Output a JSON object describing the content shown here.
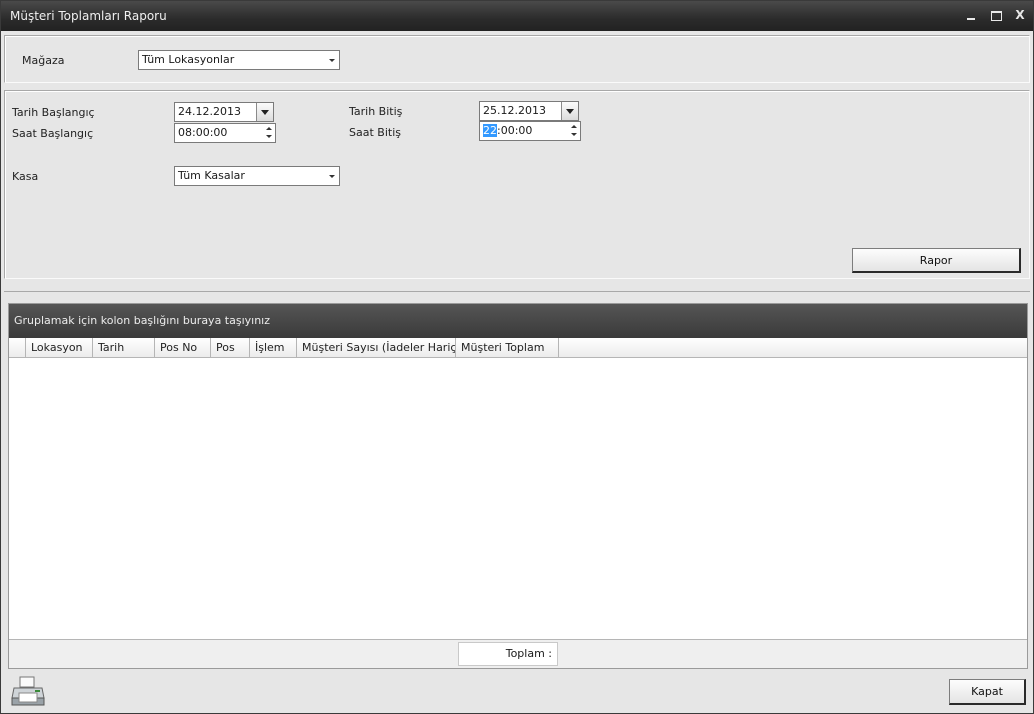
{
  "window": {
    "title": "Müşteri Toplamları Raporu",
    "controls": {
      "minimize": "minimize-icon",
      "maximize": "maximize-icon",
      "close_glyph": "X"
    }
  },
  "store": {
    "label": "Mağaza",
    "value": "Tüm Lokasyonlar"
  },
  "filters": {
    "date_start_label": "Tarih Başlangıç",
    "date_start_value": "24.12.2013",
    "time_start_label": "Saat Başlangıç",
    "time_start_value": "08:00:00",
    "date_end_label": "Tarih Bitiş",
    "date_end_value": "25.12.2013",
    "time_end_label": "Saat Bitiş",
    "time_end_selected": "22",
    "time_end_rest": ":00:00",
    "register_label": "Kasa",
    "register_value": "Tüm Kasalar",
    "report_button": "Rapor"
  },
  "grid": {
    "group_panel_text": "Gruplamak için kolon başlığını buraya taşıyınız",
    "columns": [
      "Lokasyon",
      "Tarih",
      "Pos No",
      "Pos",
      "İşlem",
      "Müşteri Sayısı (İadeler Hariç)",
      "Müşteri Toplam"
    ],
    "rows": [],
    "footer_total_label": "Toplam :"
  },
  "bottom": {
    "print_icon": "printer-icon",
    "close_button": "Kapat"
  }
}
